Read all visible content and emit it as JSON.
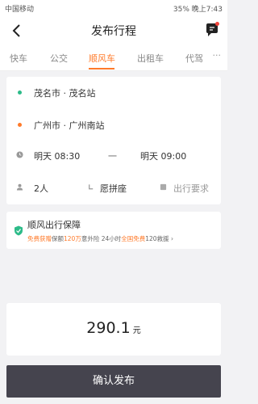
{
  "status_bar": {
    "carrier": "中国移动",
    "battery": "35%",
    "time": "晚上7:43"
  },
  "nav": {
    "title": "发布行程"
  },
  "tabs": [
    "快车",
    "公交",
    "顺风车",
    "出租车",
    "代驾"
  ],
  "tab_more": "···",
  "trip": {
    "origin": "茂名市 · 茂名站",
    "destination": "广州市 · 广州南站",
    "time_start": "明天 08:30",
    "time_sep": "一",
    "time_end": "明天 09:00",
    "passengers": "2人",
    "carpool": "愿拼座",
    "requirements": "出行要求"
  },
  "guarantee": {
    "title": "顺风出行保障",
    "sub_hl1": "免费获赠",
    "sub_t1": "保额",
    "sub_hl2": "120万",
    "sub_t2": "意外险 24小时",
    "sub_hl3": "全国免费",
    "sub_t3": "120救援",
    "arrow": "›"
  },
  "price": {
    "amount": "290.1",
    "unit": "元"
  },
  "confirm_label": "确认发布"
}
